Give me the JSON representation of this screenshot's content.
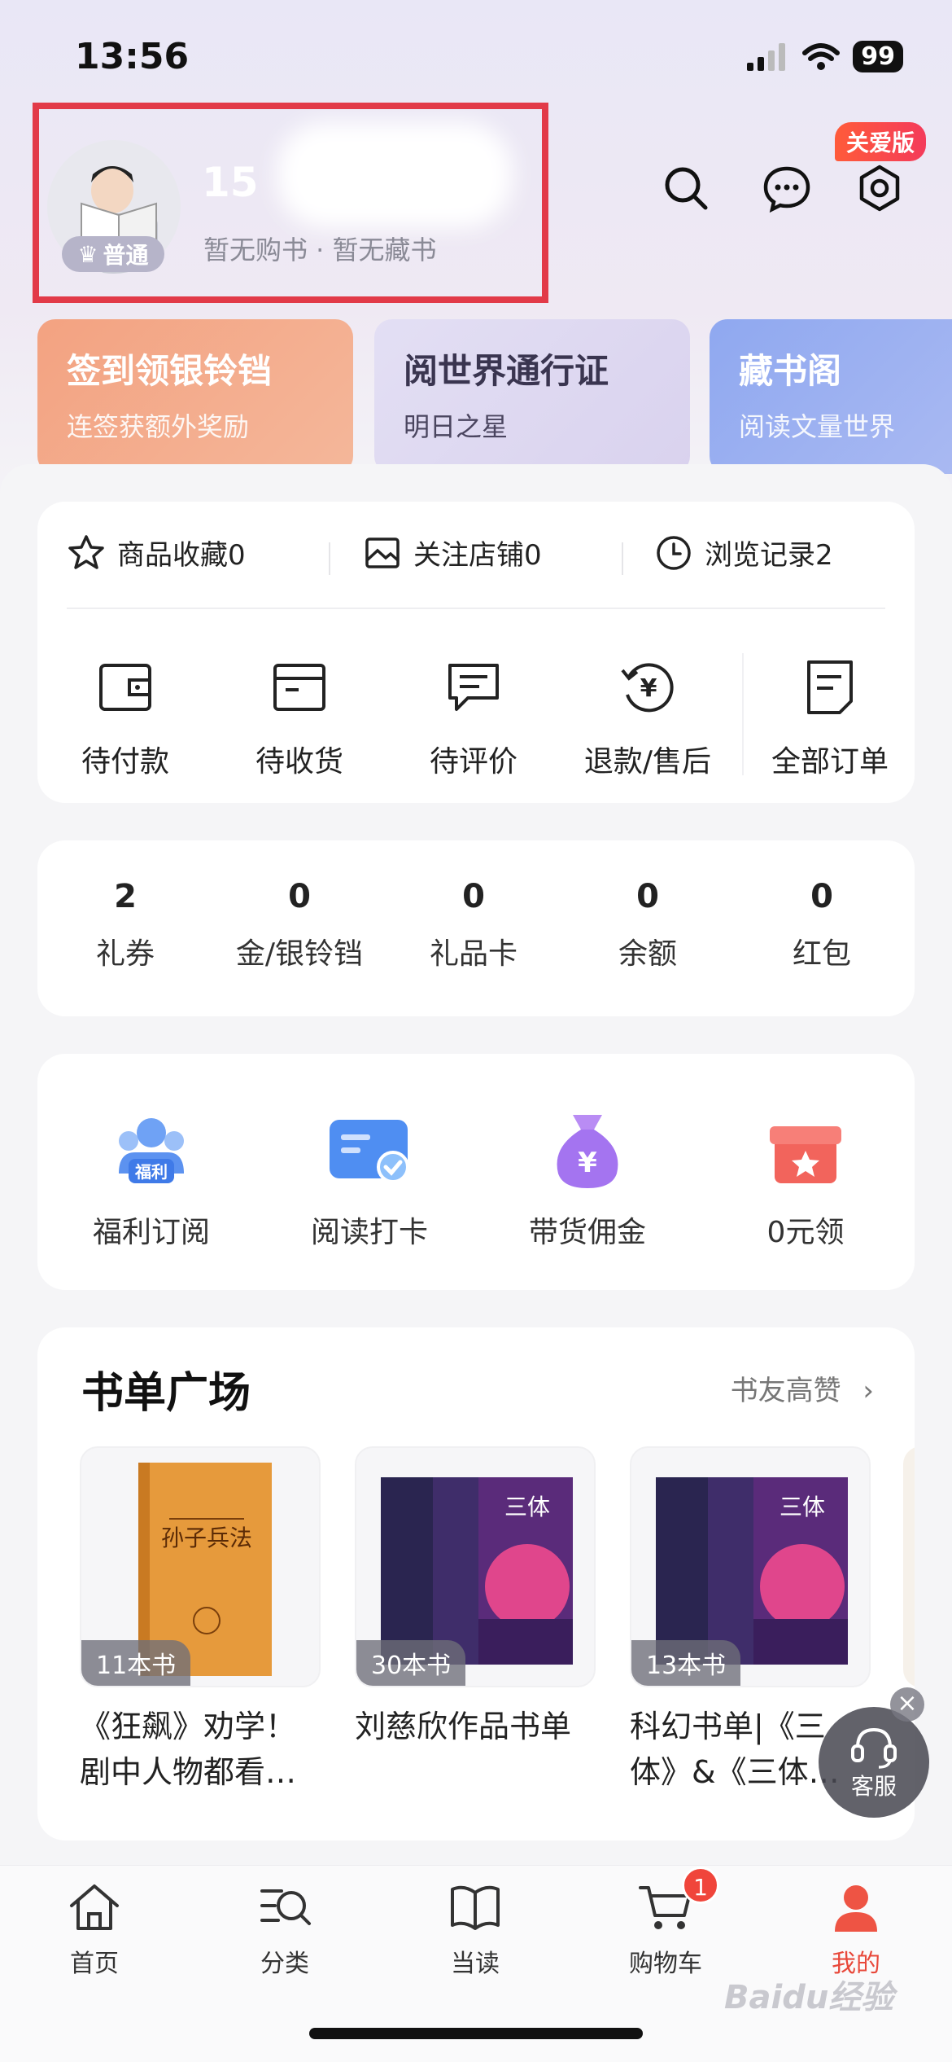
{
  "status": {
    "time": "13:56",
    "battery": "99"
  },
  "header": {
    "level": "普通",
    "phone_prefix": "15",
    "subinfo": "暂无购书 · 暂无藏书",
    "care_badge": "关爱版"
  },
  "promos": [
    {
      "title": "签到领银铃铛",
      "subtitle": "连签获额外奖励"
    },
    {
      "title": "阅世界通行证",
      "subtitle": "明日之星"
    },
    {
      "title": "藏书阁",
      "subtitle": "阅读文量世界"
    }
  ],
  "favorites": [
    {
      "label": "商品收藏0"
    },
    {
      "label": "关注店铺0"
    },
    {
      "label": "浏览记录2"
    }
  ],
  "orders": [
    {
      "label": "待付款"
    },
    {
      "label": "待收货"
    },
    {
      "label": "待评价"
    },
    {
      "label": "退款/售后"
    },
    {
      "label": "全部订单"
    }
  ],
  "assets": [
    {
      "value": "2",
      "label": "礼券"
    },
    {
      "value": "0",
      "label": "金/银铃铛"
    },
    {
      "value": "0",
      "label": "礼品卡"
    },
    {
      "value": "0",
      "label": "余额"
    },
    {
      "value": "0",
      "label": "红包"
    }
  ],
  "tools": [
    {
      "label": "福利订阅",
      "icon_text": "福利"
    },
    {
      "label": "阅读打卡"
    },
    {
      "label": "带货佣金",
      "icon_text": "¥"
    },
    {
      "label": "0元领"
    }
  ],
  "booklist": {
    "title": "书单广场",
    "link": "书友高赞",
    "books": [
      {
        "count": "11本书",
        "title": "《狂飙》劝学！剧中人物都看…",
        "cover_text": "孙子兵法"
      },
      {
        "count": "30本书",
        "title": "刘慈欣作品书单",
        "cover_text": "三体"
      },
      {
        "count": "13本书",
        "title": "科幻书单|《三体》&《三体…",
        "cover_text": "三体"
      }
    ]
  },
  "customer_service": {
    "label": "客服",
    "close": "×"
  },
  "tabbar": {
    "items": [
      {
        "label": "首页"
      },
      {
        "label": "分类"
      },
      {
        "label": "当读"
      },
      {
        "label": "购物车"
      },
      {
        "label": "我的"
      }
    ],
    "cart_badge": "1"
  },
  "watermark": "Baidu经验",
  "colors": {
    "accent": "#e8483a",
    "highlight_box": "#e23a48"
  }
}
